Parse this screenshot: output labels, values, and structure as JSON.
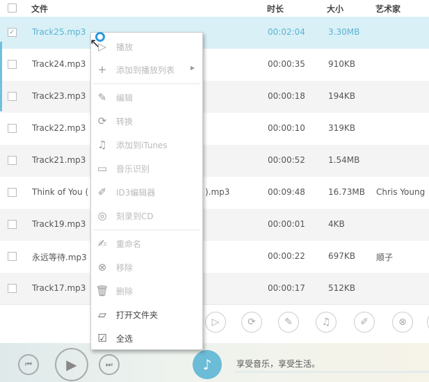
{
  "header": {
    "file": "文件",
    "duration": "时长",
    "size": "大小",
    "artist": "艺术家"
  },
  "rows": [
    {
      "name": "Track25.mp3",
      "duration": "00:02:04",
      "size": "3.30MB",
      "artist": "",
      "selected": true
    },
    {
      "name": "Track24.mp3",
      "duration": "00:00:35",
      "size": "910KB",
      "artist": ""
    },
    {
      "name": "Track23.mp3",
      "duration": "00:00:18",
      "size": "194KB",
      "artist": ""
    },
    {
      "name": "Track22.mp3",
      "duration": "00:00:10",
      "size": "319KB",
      "artist": ""
    },
    {
      "name": "Track21.mp3",
      "duration": "00:00:52",
      "size": "1.54MB",
      "artist": ""
    },
    {
      "name": "Think of You (",
      "name_tail": ").mp3",
      "duration": "00:09:48",
      "size": "16.73MB",
      "artist": "Chris Young"
    },
    {
      "name": "Track19.mp3",
      "duration": "00:00:01",
      "size": "4KB",
      "artist": ""
    },
    {
      "name": "永远等待.mp3",
      "duration": "00:00:22",
      "size": "697KB",
      "artist": "顺子"
    },
    {
      "name": "Track17.mp3",
      "duration": "00:00:17",
      "size": "512KB",
      "artist": ""
    }
  ],
  "menu": [
    {
      "label": "播放",
      "icon": "play-icon",
      "enabled": false
    },
    {
      "label": "添加到播放列表",
      "icon": "plus-icon",
      "enabled": false,
      "submenu": true
    },
    {
      "label": "编辑",
      "icon": "pencil-icon",
      "enabled": false
    },
    {
      "label": "转换",
      "icon": "convert-icon",
      "enabled": false
    },
    {
      "label": "添加到iTunes",
      "icon": "itunes-icon",
      "enabled": false
    },
    {
      "label": "音乐识别",
      "icon": "id-card-icon",
      "enabled": false
    },
    {
      "label": "ID3编辑器",
      "icon": "id3-edit-icon",
      "enabled": false
    },
    {
      "label": "刻录到CD",
      "icon": "cd-icon",
      "enabled": false
    },
    {
      "label": "重命名",
      "icon": "rename-icon",
      "enabled": false
    },
    {
      "label": "移除",
      "icon": "remove-icon",
      "enabled": false
    },
    {
      "label": "删除",
      "icon": "trash-icon",
      "enabled": false
    },
    {
      "label": "打开文件夹",
      "icon": "folder-icon",
      "enabled": true
    },
    {
      "label": "全选",
      "icon": "select-all-icon",
      "enabled": true
    }
  ],
  "player": {
    "slogan": "享受音乐，享受生活。"
  },
  "colors": {
    "accent": "#6ec0dc",
    "selected_row": "#d9f0f7"
  }
}
